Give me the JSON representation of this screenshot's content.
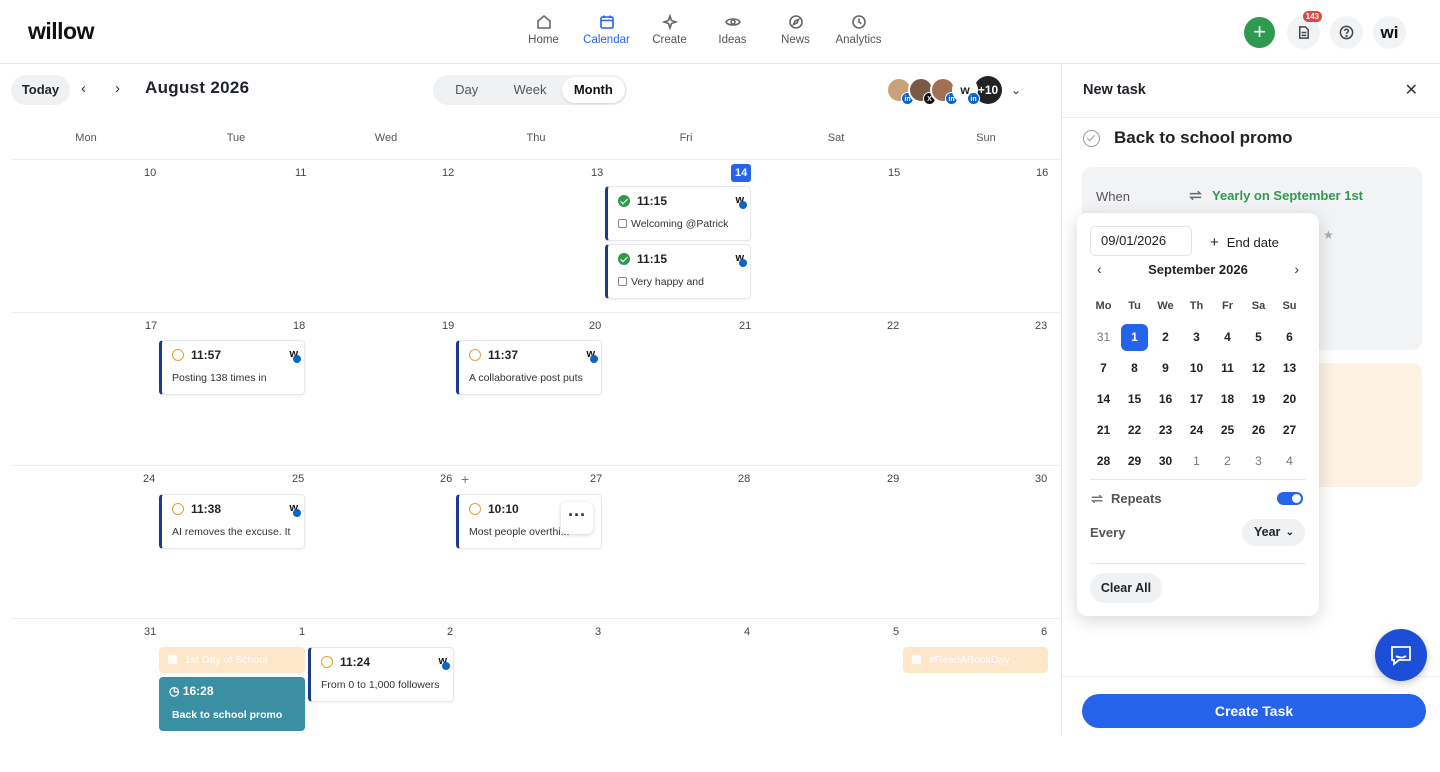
{
  "app": {
    "logo": "willow"
  },
  "nav": [
    {
      "label": "Home",
      "icon": "home-icon"
    },
    {
      "label": "Calendar",
      "icon": "calendar-icon",
      "active": true
    },
    {
      "label": "Create",
      "icon": "sparkle-icon"
    },
    {
      "label": "Ideas",
      "icon": "eye-icon"
    },
    {
      "label": "News",
      "icon": "compass-icon"
    },
    {
      "label": "Analytics",
      "icon": "clock-icon"
    }
  ],
  "topright": {
    "notification_count": "143",
    "avatar": "wi"
  },
  "toolbar": {
    "today": "Today",
    "month_title": "August 2026",
    "views": [
      "Day",
      "Week",
      "Month"
    ],
    "active_view": "Month",
    "more_accounts": "+10"
  },
  "weekdays": [
    "Mon",
    "Tue",
    "Wed",
    "Thu",
    "Fri",
    "Sat",
    "Sun"
  ],
  "weeks": [
    [
      "10",
      "11",
      "12",
      "13",
      "14",
      "15",
      "16"
    ],
    [
      "17",
      "18",
      "19",
      "20",
      "21",
      "22",
      "23"
    ],
    [
      "24",
      "25",
      "26",
      "27",
      "28",
      "29",
      "30"
    ],
    [
      "31",
      "1",
      "2",
      "3",
      "4",
      "5",
      "6"
    ]
  ],
  "today_date": "14",
  "posts": [
    {
      "time": "11:15",
      "text": "Welcoming @Patrick",
      "status": "published"
    },
    {
      "time": "11:15",
      "text": "Very happy and",
      "status": "published"
    },
    {
      "time": "11:57",
      "text": "Posting 138 times in",
      "status": "scheduled"
    },
    {
      "time": "11:37",
      "text": "A collaborative post puts",
      "status": "scheduled"
    },
    {
      "time": "11:38",
      "text": "AI removes the excuse. It",
      "status": "scheduled"
    },
    {
      "time": "10:10",
      "text": "Most people overthi...",
      "status": "scheduled"
    },
    {
      "time": "11:24",
      "text": "From 0 to 1,000 followers",
      "status": "scheduled"
    }
  ],
  "holidays": [
    "1st Day of School",
    "#ReadABookDay"
  ],
  "task_card": {
    "time": "16:28",
    "label": "Back to school promo"
  },
  "panel": {
    "title": "New task",
    "task_title": "Back to school promo",
    "when_label": "When",
    "when_value": "Yearly on September 1st",
    "create_button": "Create Task"
  },
  "datepicker": {
    "date_value": "09/01/2026",
    "end_date_label": "End date",
    "month_title": "September 2026",
    "dow": [
      "Mo",
      "Tu",
      "We",
      "Th",
      "Fr",
      "Sa",
      "Su"
    ],
    "days": [
      [
        "31",
        "1",
        "2",
        "3",
        "4",
        "5",
        "6"
      ],
      [
        "7",
        "8",
        "9",
        "10",
        "11",
        "12",
        "13"
      ],
      [
        "14",
        "15",
        "16",
        "17",
        "18",
        "19",
        "20"
      ],
      [
        "21",
        "22",
        "23",
        "24",
        "25",
        "26",
        "27"
      ],
      [
        "28",
        "29",
        "30",
        "1",
        "2",
        "3",
        "4"
      ]
    ],
    "selected": "1",
    "repeats_label": "Repeats",
    "repeats_on": true,
    "every_label": "Every",
    "every_value": "Year",
    "clear_all": "Clear All"
  },
  "colors": {
    "accent": "#2563eb",
    "success": "#2e9a4f",
    "task": "#3a8fa3",
    "holiday": "#fde7c8"
  }
}
